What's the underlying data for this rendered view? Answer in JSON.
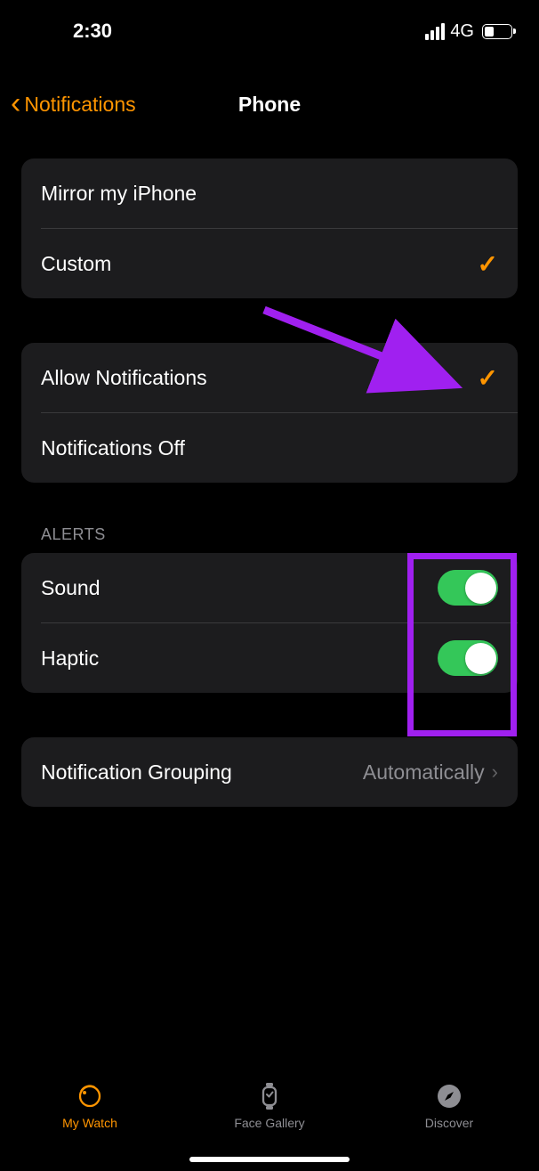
{
  "status": {
    "time": "2:30",
    "network": "4G"
  },
  "nav": {
    "back_label": "Notifications",
    "title": "Phone"
  },
  "mirror_group": {
    "mirror": "Mirror my iPhone",
    "custom": "Custom"
  },
  "allow_group": {
    "allow": "Allow Notifications",
    "off": "Notifications Off"
  },
  "alerts": {
    "header": "ALERTS",
    "sound": "Sound",
    "haptic": "Haptic"
  },
  "grouping": {
    "label": "Notification Grouping",
    "value": "Automatically"
  },
  "tabs": {
    "mywatch": "My Watch",
    "facegallery": "Face Gallery",
    "discover": "Discover"
  }
}
